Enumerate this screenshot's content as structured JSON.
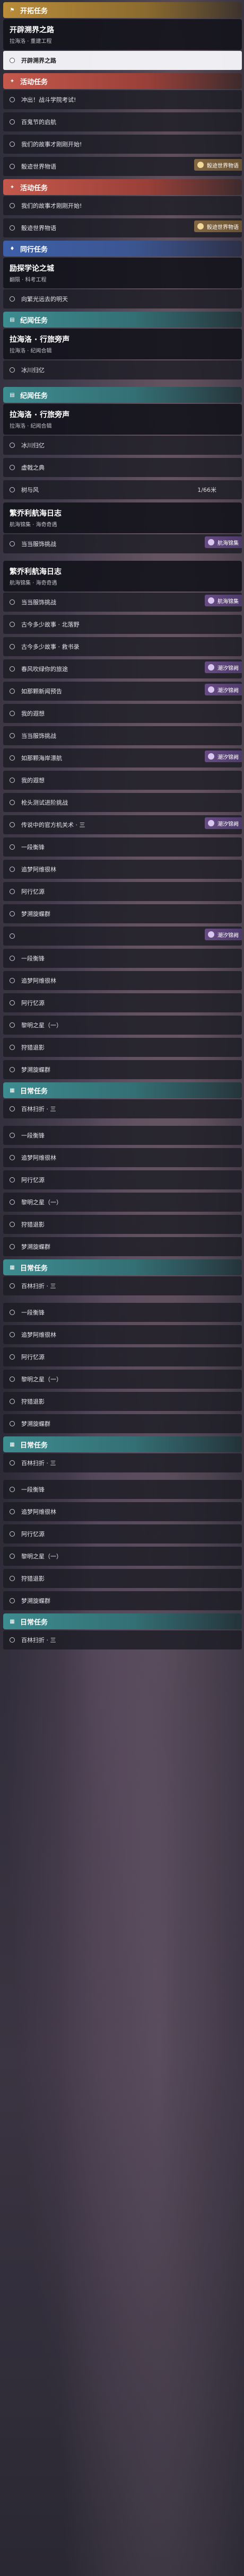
{
  "sections": [
    {
      "header": "开拓任务",
      "header_kind": "main",
      "header_icon": "flag-icon"
    },
    {
      "card": {
        "title": "开辟溯界之路",
        "subtitle": "拉海洛 · 重建工程"
      }
    },
    {
      "row": {
        "label": "开辟溯界之路",
        "selected": true
      }
    },
    {
      "header": "活动任务",
      "header_kind": "act",
      "header_icon": "event-icon"
    },
    {
      "row": {
        "label": "冲出！战斗学院考试!"
      }
    },
    {
      "row": {
        "label": "百鬼节的启航"
      }
    },
    {
      "row": {
        "label": "我们的故事才刚刚开始!"
      }
    },
    {
      "row": {
        "label": "骰迹世界物语",
        "tag": "骰迹世界物语",
        "tag_kind": "gold"
      }
    },
    {
      "header": "活动任务",
      "header_kind": "act",
      "header_icon": "event-icon"
    },
    {
      "row": {
        "label": "我们的故事才刚刚开始!"
      }
    },
    {
      "row": {
        "label": "骰迹世界物语",
        "tag": "骰迹世界物语",
        "tag_kind": "gold"
      }
    },
    {
      "header": "同行任务",
      "header_kind": "comp",
      "header_icon": "companion-icon"
    },
    {
      "card": {
        "title": "励探学论之城",
        "subtitle": "翻陨 · 科考工程"
      }
    },
    {
      "row": {
        "label": "向繁光远去的明天"
      }
    },
    {
      "header": "纪闻任务",
      "header_kind": "trail",
      "header_icon": "book-icon"
    },
    {
      "card": {
        "title": "拉海洛 · 行旅旁声",
        "subtitle": "拉海洛 · 纪闻合辑"
      }
    },
    {
      "row": {
        "label": "冰川归亿"
      }
    },
    {
      "gap": true
    },
    {
      "header": "纪闻任务",
      "header_kind": "trail",
      "header_icon": "book-icon"
    },
    {
      "card": {
        "title": "拉海洛 · 行旅旁声",
        "subtitle": "拉海洛 · 纪闻合辑"
      }
    },
    {
      "row": {
        "label": "冰川归亿"
      }
    },
    {
      "row": {
        "label": "虚戟之典"
      }
    },
    {
      "row": {
        "label": "树与风",
        "count": "1/66米"
      }
    },
    {
      "card": {
        "title": "繁乔利航海日志",
        "subtitle": "航海锦集 · 海奇奇遇"
      }
    },
    {
      "row": {
        "label": "当当服饰挑战",
        "tag": "航海锦集",
        "tag_kind": "purple"
      }
    },
    {
      "gap": true
    },
    {
      "card": {
        "title": "繁乔利航海日志",
        "subtitle": "航海锦集 · 海奇奇遇"
      }
    },
    {
      "row": {
        "label": "当当服饰挑战",
        "tag": "航海锦集",
        "tag_kind": "purple"
      }
    },
    {
      "row": {
        "label": "古今多少故事 · 北落野"
      }
    },
    {
      "row": {
        "label": "古今多少故事 · 救书录"
      }
    },
    {
      "row": {
        "label": "春风吹绿你的旅途",
        "tag": "潮汐锦阙",
        "tag_kind": "purple"
      }
    },
    {
      "row": {
        "label": "如那颗新闻预告",
        "tag": "潮汐锦阙",
        "tag_kind": "purple"
      }
    },
    {
      "row": {
        "label": "我的遐想"
      }
    },
    {
      "row": {
        "label": "当当服饰挑战"
      }
    },
    {
      "row": {
        "label": "如那颗海岸漂航",
        "tag": "潮汐锦阙",
        "tag_kind": "purple"
      }
    },
    {
      "row": {
        "label": "我的遐想"
      }
    },
    {
      "row": {
        "label": "枪头测试进阶挑战"
      }
    },
    {
      "row": {
        "label": "传说中的官方机关术 · 三",
        "tag": "潮汐锦阙",
        "tag_kind": "purple"
      }
    },
    {
      "row": {
        "label": "一段衡锋"
      }
    },
    {
      "row": {
        "label": "追梦阿维很林"
      }
    },
    {
      "row": {
        "label": "阿行忆源"
      }
    },
    {
      "row": {
        "label": "梦溯旋蝶群"
      }
    },
    {
      "row": {
        "label": "",
        "tag": "潮汐锦阙",
        "tag_kind": "purple"
      }
    },
    {
      "row": {
        "label": "一段衡锋"
      }
    },
    {
      "row": {
        "label": "追梦阿维很林"
      }
    },
    {
      "row": {
        "label": "阿行忆源"
      }
    },
    {
      "row": {
        "label": "黎明之星（一）"
      }
    },
    {
      "row": {
        "label": "狩猎退影"
      }
    },
    {
      "row": {
        "label": "梦溯旋蝶群"
      }
    },
    {
      "header": "日常任务",
      "header_kind": "trail",
      "header_icon": "calendar-icon"
    },
    {
      "row": {
        "label": "百林扫折 · 三"
      }
    },
    {
      "gap": true
    },
    {
      "row": {
        "label": "一段衡锋"
      }
    },
    {
      "row": {
        "label": "追梦阿维很林"
      }
    },
    {
      "row": {
        "label": "阿行忆源"
      }
    },
    {
      "row": {
        "label": "黎明之星（一）"
      }
    },
    {
      "row": {
        "label": "狩猎退影"
      }
    },
    {
      "row": {
        "label": "梦溯旋蝶群"
      }
    },
    {
      "header": "日常任务",
      "header_kind": "trail",
      "header_icon": "calendar-icon"
    },
    {
      "row": {
        "label": "百林扫折 · 三"
      }
    },
    {
      "gap": true
    },
    {
      "row": {
        "label": "一段衡锋"
      }
    },
    {
      "row": {
        "label": "追梦阿维很林"
      }
    },
    {
      "row": {
        "label": "阿行忆源"
      }
    },
    {
      "row": {
        "label": "黎明之星（一）"
      }
    },
    {
      "row": {
        "label": "狩猎退影"
      }
    },
    {
      "row": {
        "label": "梦溯旋蝶群"
      }
    },
    {
      "header": "日常任务",
      "header_kind": "trail",
      "header_icon": "calendar-icon"
    },
    {
      "row": {
        "label": "百林扫折 · 三"
      }
    },
    {
      "gap": true
    },
    {
      "row": {
        "label": "一段衡锋"
      }
    },
    {
      "row": {
        "label": "追梦阿维很林"
      }
    },
    {
      "row": {
        "label": "阿行忆源"
      }
    },
    {
      "row": {
        "label": "黎明之星（一）"
      }
    },
    {
      "row": {
        "label": "狩猎退影"
      }
    },
    {
      "row": {
        "label": "梦溯旋蝶群"
      }
    },
    {
      "header": "日常任务",
      "header_kind": "trail",
      "header_icon": "calendar-icon"
    },
    {
      "row": {
        "label": "百林扫折 · 三"
      }
    }
  ]
}
